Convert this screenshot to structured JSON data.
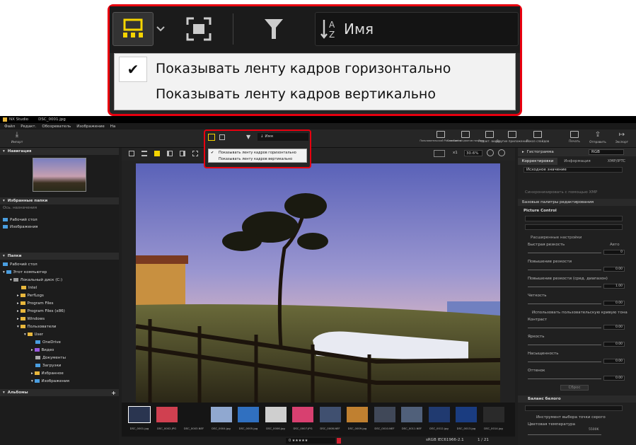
{
  "app": {
    "title": "NX Studio",
    "file": "DSC_0001.jpg"
  },
  "menu": [
    "Файл",
    "Редакт.",
    "Обозреватель",
    "Изображение",
    "На"
  ],
  "toolbar": {
    "import": "Импорт",
    "picture_control": "Пользовательский Picture Control",
    "pixel_shift": "Слияние со сдвигом пикселя",
    "video": "Редакт. видео",
    "other_apps": "Другие приложения",
    "slideshow": "Показ слайдов",
    "print": "Печать",
    "send": "Отправить",
    "export": "Экспорт"
  },
  "zoom": {
    "sort_label": "Имя",
    "menu_items": [
      "Показывать ленту кадров горизонтально",
      "Показывать ленту кадров вертикально"
    ],
    "checked_index": 0
  },
  "left": {
    "navigation": "Навигация",
    "favorites": "Избранные папки",
    "favorites_hint": "Ось. назначения",
    "fav_items": [
      "Рабочий стол",
      "Изображения"
    ],
    "folders": "Папки",
    "tree": [
      "Рабочий стол",
      "Этот компьютер",
      "Локальный диск (C:)",
      "Intel",
      "PerfLogs",
      "Program Files",
      "Program Files (x86)",
      "Windows",
      "Пользователи",
      "User",
      "OneDrive",
      "Видео",
      "Документы",
      "Загрузки",
      "Избранное",
      "Изображения"
    ],
    "albums": "Альбомы"
  },
  "viewbar": {
    "zoom": "30.6%",
    "multiplier": "x1"
  },
  "filmstrip": [
    "DSC_0001.jpg",
    "DSC_0002.JPG",
    "DSC_0003.NEF",
    "DSC_0004.jpg",
    "DSC_0005.jpg",
    "DSC_0006.jpg",
    "DSC_0007.JPG",
    "DSC_0008.NEF",
    "DSC_0009.jpg",
    "DSC_0010.NEF",
    "DSC_0011.NEF",
    "DSC_0012.jpg",
    "DSC_0013.jpg",
    "DSC_0014.jpg"
  ],
  "status": {
    "colorspace": "sRGB IEC61966-2.1",
    "page": "1 / 21"
  },
  "right": {
    "histogram": "Гистограмма",
    "histogram_mode": "RGB",
    "tabs": [
      "Корректировки",
      "Информация",
      "XMP/IPTC"
    ],
    "preset": "Исходное значение",
    "sync": "Синхронизировать с помощью XMP",
    "basic": "Базовые палитры редактирования",
    "picture_control": "Picture Control",
    "advanced": "Расширенные настройки",
    "quick_sharp": "Быстрая резкость",
    "auto": "Авто",
    "sharpening": "Повышение резкости",
    "mid_sharp": "Повышение резкости (сред. диапазон)",
    "clarity": "Четкость",
    "custom_curve": "Использовать пользовательскую кривую тона",
    "contrast": "Контраст",
    "brightness": "Яркость",
    "saturation": "Насыщенность",
    "hue": "Оттенок",
    "reset": "Сброс",
    "wb": "Баланс белого",
    "wb_tool": "Инструмент выбора точки серого",
    "color_temp": "Цветовая температура",
    "temp_value": "5500K",
    "values": [
      "0",
      "0.00",
      "1.00",
      "0.00",
      "0.00",
      "0.00",
      "0.00",
      "0.00"
    ]
  }
}
